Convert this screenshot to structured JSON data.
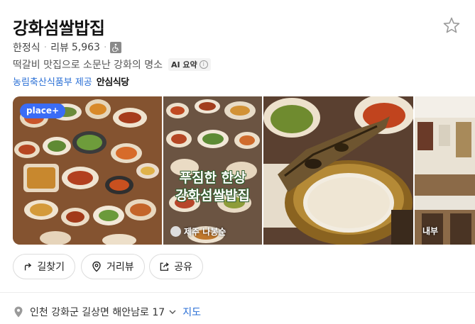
{
  "place": {
    "name": "강화섬쌀밥집",
    "category": "한정식",
    "review_label": "리뷰",
    "review_count": "5,963",
    "description": "떡갈비 맛집으로 소문난 강화의 명소",
    "ai_summary_label": "AI 요약",
    "certification_link": "농림축산식품부 제공",
    "certification_badge": "안심식당"
  },
  "photos": {
    "badge": "place+",
    "overlay_line1": "푸짐한 한상",
    "overlay_line2": "강화섬쌀밥집",
    "author": "제주 나봉순",
    "interior_label": "내부"
  },
  "actions": {
    "route": "길찾기",
    "streetview": "거리뷰",
    "share": "공유"
  },
  "address": {
    "text": "인천 강화군 길상면 해안남로 17",
    "map_link": "지도"
  },
  "colors": {
    "link": "#2a6fd6",
    "badge": "#3a6cf6",
    "overlay_outline": "#2f5d2c"
  },
  "icons": [
    "star-icon",
    "wheelchair-icon",
    "info-icon",
    "route-arrow-icon",
    "location-pin-icon",
    "share-icon",
    "map-pin-icon",
    "chevron-down-icon"
  ]
}
